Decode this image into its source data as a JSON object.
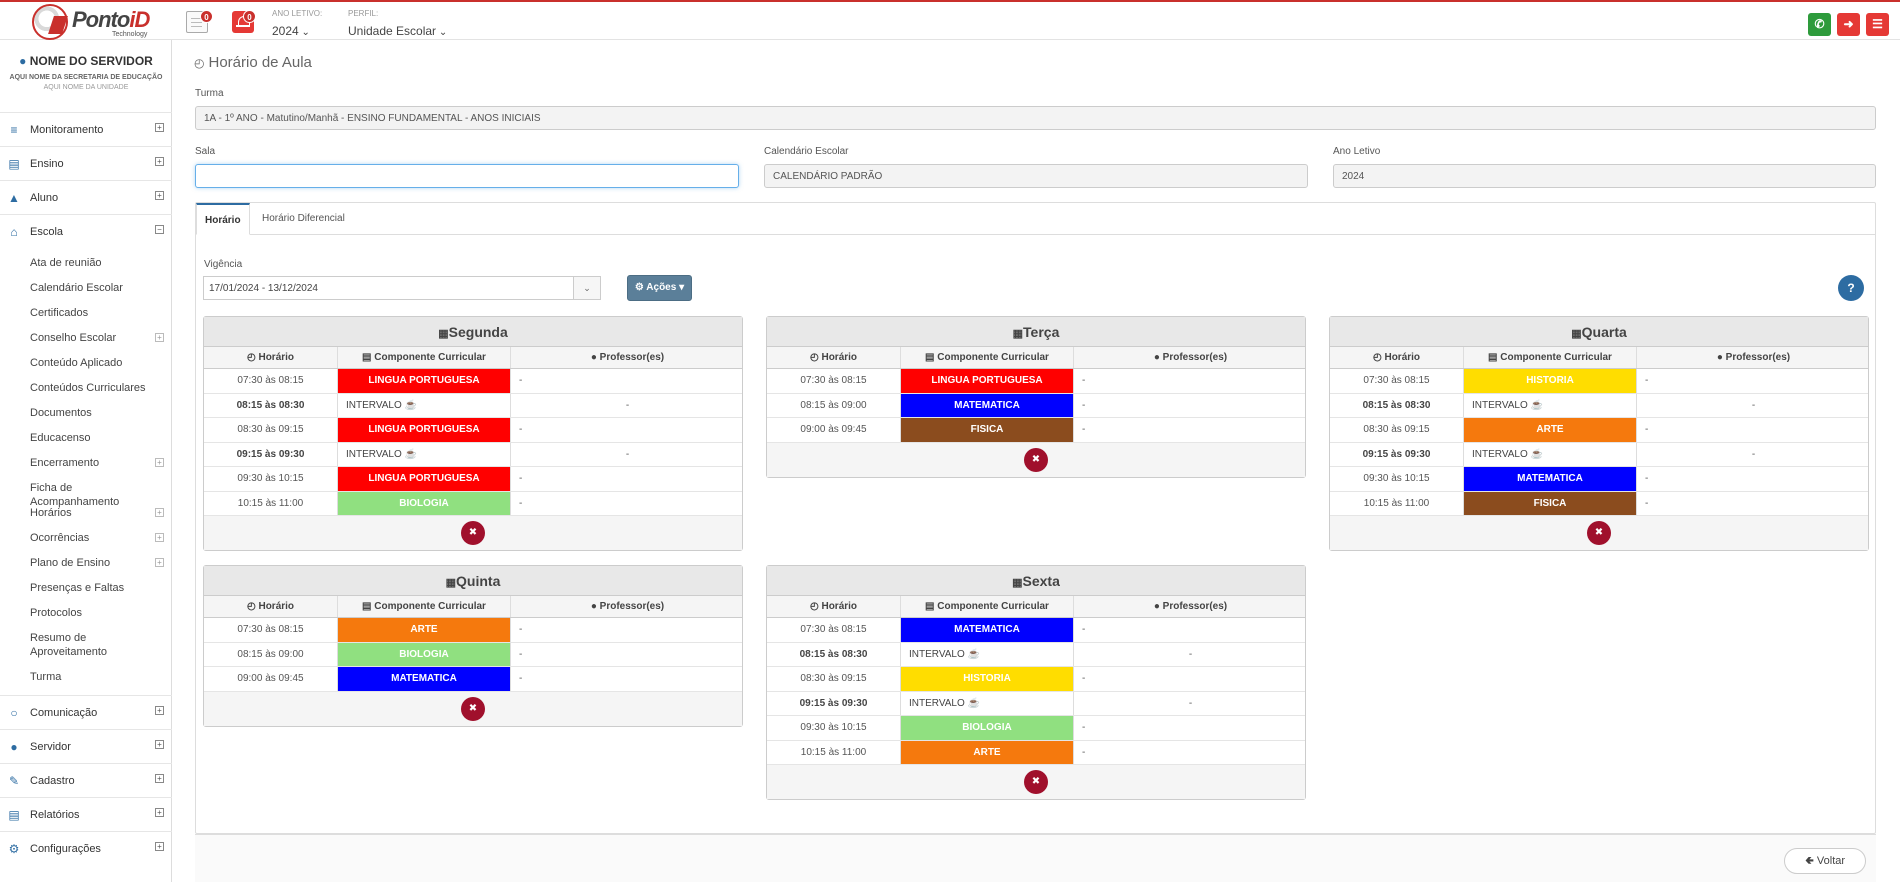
{
  "brand": {
    "logo_text": "Ponto",
    "logo_accent": "iD",
    "logo_sub": "Technology"
  },
  "topbar": {
    "docs_badge": "0",
    "alerts_badge": "0",
    "ano_letivo_label": "ANO LETIVO:",
    "ano_letivo_value": "2024",
    "perfil_label": "PERFIL:",
    "perfil_value": "Unidade Escolar",
    "colors": {
      "whatsapp": "#2e9b3c",
      "logout": "#e53935",
      "menu": "#e53935"
    }
  },
  "sidebar": {
    "user_name": "NOME DO SERVIDOR",
    "secretaria": "AQUI NOME DA SECRETARIA DE EDUCAÇÃO",
    "unidade": "AQUI NOME DA UNIDADE",
    "top_items": [
      {
        "label": "Monitoramento",
        "icon": "sliders-icon"
      },
      {
        "label": "Ensino",
        "icon": "book-icon"
      },
      {
        "label": "Aluno",
        "icon": "graduation-cap-icon"
      },
      {
        "label": "Escola",
        "icon": "bank-icon"
      }
    ],
    "escola_items": [
      "Ata de reunião",
      "Calendário Escolar",
      "Certificados",
      "Conselho Escolar",
      "Conteúdo Aplicado",
      "Conteúdos Curriculares",
      "Documentos",
      "Educacenso",
      "Encerramento",
      "Ficha de Acompanhamento",
      "Horários",
      "Ocorrências",
      "Plano de Ensino",
      "Presenças e Faltas",
      "Protocolos",
      "Resumo de Aproveitamento",
      "Turma"
    ],
    "bottom_items": [
      {
        "label": "Comunicação",
        "icon": "chat-icon"
      },
      {
        "label": "Servidor",
        "icon": "user-icon"
      },
      {
        "label": "Cadastro",
        "icon": "edit-icon"
      },
      {
        "label": "Relatórios",
        "icon": "report-icon"
      },
      {
        "label": "Configurações",
        "icon": "gear-icon"
      }
    ]
  },
  "page": {
    "title": "Horário de Aula",
    "turma_label": "Turma",
    "turma_value": "1A - 1º ANO - Matutino/Manhã - ENSINO FUNDAMENTAL - ANOS INICIAIS",
    "sala_label": "Sala",
    "sala_value": "",
    "calendario_label": "Calendário Escolar",
    "calendario_value": "CALENDÁRIO PADRÃO",
    "ano_label": "Ano Letivo",
    "ano_value": "2024",
    "tab_horario": "Horário",
    "tab_diferencial": "Horário Diferencial",
    "vigencia_label": "Vigência",
    "vigencia_value": "17/01/2024 - 13/12/2024",
    "acoes_label": "Ações",
    "help_label": "?",
    "col_horario": "Horário",
    "col_componente": "Componente Curricular",
    "col_professor": "Professor(es)",
    "voltar_label": "Voltar"
  },
  "subject_colors": {
    "LINGUA PORTUGUESA": "#ff0000",
    "BIOLOGIA": "#90e080",
    "MATEMATICA": "#0000ff",
    "FISICA": "#8b4c1e",
    "HISTORIA": "#ffdd00",
    "ARTE": "#f5790d"
  },
  "days": [
    {
      "name": "Segunda",
      "rows": [
        {
          "time": "07:30 às 08:15",
          "subject": "LINGUA PORTUGUESA",
          "prof": "-"
        },
        {
          "time": "08:15 às 08:30",
          "subject": "INTERVALO",
          "prof": "-",
          "interval": true
        },
        {
          "time": "08:30 às 09:15",
          "subject": "LINGUA PORTUGUESA",
          "prof": "-"
        },
        {
          "time": "09:15 às 09:30",
          "subject": "INTERVALO",
          "prof": "-",
          "interval": true
        },
        {
          "time": "09:30 às 10:15",
          "subject": "LINGUA PORTUGUESA",
          "prof": "-"
        },
        {
          "time": "10:15 às 11:00",
          "subject": "BIOLOGIA",
          "prof": "-"
        }
      ]
    },
    {
      "name": "Terça",
      "rows": [
        {
          "time": "07:30 às 08:15",
          "subject": "LINGUA PORTUGUESA",
          "prof": "-"
        },
        {
          "time": "08:15 às 09:00",
          "subject": "MATEMATICA",
          "prof": "-"
        },
        {
          "time": "09:00 às 09:45",
          "subject": "FISICA",
          "prof": "-"
        }
      ]
    },
    {
      "name": "Quarta",
      "rows": [
        {
          "time": "07:30 às 08:15",
          "subject": "HISTORIA",
          "prof": "-"
        },
        {
          "time": "08:15 às 08:30",
          "subject": "INTERVALO",
          "prof": "-",
          "interval": true
        },
        {
          "time": "08:30 às 09:15",
          "subject": "ARTE",
          "prof": "-"
        },
        {
          "time": "09:15 às 09:30",
          "subject": "INTERVALO",
          "prof": "-",
          "interval": true
        },
        {
          "time": "09:30 às 10:15",
          "subject": "MATEMATICA",
          "prof": "-"
        },
        {
          "time": "10:15 às 11:00",
          "subject": "FISICA",
          "prof": "-"
        }
      ]
    },
    {
      "name": "Quinta",
      "rows": [
        {
          "time": "07:30 às 08:15",
          "subject": "ARTE",
          "prof": "-"
        },
        {
          "time": "08:15 às 09:00",
          "subject": "BIOLOGIA",
          "prof": "-"
        },
        {
          "time": "09:00 às 09:45",
          "subject": "MATEMATICA",
          "prof": "-"
        }
      ]
    },
    {
      "name": "Sexta",
      "rows": [
        {
          "time": "07:30 às 08:15",
          "subject": "MATEMATICA",
          "prof": "-"
        },
        {
          "time": "08:15 às 08:30",
          "subject": "INTERVALO",
          "prof": "-",
          "interval": true
        },
        {
          "time": "08:30 às 09:15",
          "subject": "HISTORIA",
          "prof": "-"
        },
        {
          "time": "09:15 às 09:30",
          "subject": "INTERVALO",
          "prof": "-",
          "interval": true
        },
        {
          "time": "09:30 às 10:15",
          "subject": "BIOLOGIA",
          "prof": "-"
        },
        {
          "time": "10:15 às 11:00",
          "subject": "ARTE",
          "prof": "-"
        }
      ]
    }
  ]
}
